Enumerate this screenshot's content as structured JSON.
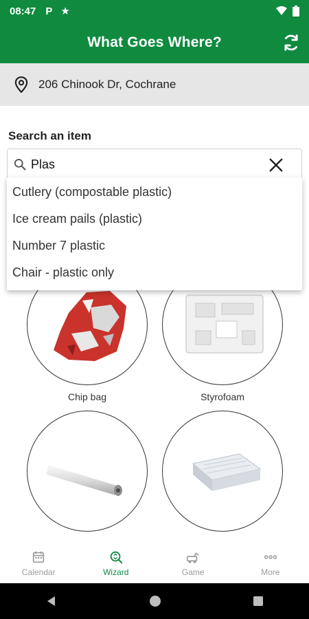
{
  "status_bar": {
    "time": "08:47",
    "icons": [
      "parking-icon",
      "star-icon",
      "wifi-icon",
      "battery-icon"
    ]
  },
  "app_bar": {
    "title": "What Goes Where?",
    "refresh_icon": "refresh-icon"
  },
  "address": {
    "text": "206 Chinook Dr, Cochrane"
  },
  "search": {
    "label": "Search an item",
    "value": "Plas",
    "suggestions": [
      "Cutlery (compostable plastic)",
      "Ice cream pails (plastic)",
      "Number 7 plastic",
      "Chair - plastic only"
    ]
  },
  "items": [
    {
      "label": "Chip bag"
    },
    {
      "label": "Styrofoam"
    },
    {
      "label": ""
    },
    {
      "label": ""
    }
  ],
  "bottom_nav": [
    {
      "label": "Calendar",
      "icon": "calendar-icon",
      "active": false
    },
    {
      "label": "Wizard",
      "icon": "wizard-icon",
      "active": true
    },
    {
      "label": "Game",
      "icon": "game-icon",
      "active": false
    },
    {
      "label": "More",
      "icon": "more-icon",
      "active": false
    }
  ],
  "colors": {
    "brand": "#0f8a3f",
    "address_bg": "#e6e6e6"
  }
}
